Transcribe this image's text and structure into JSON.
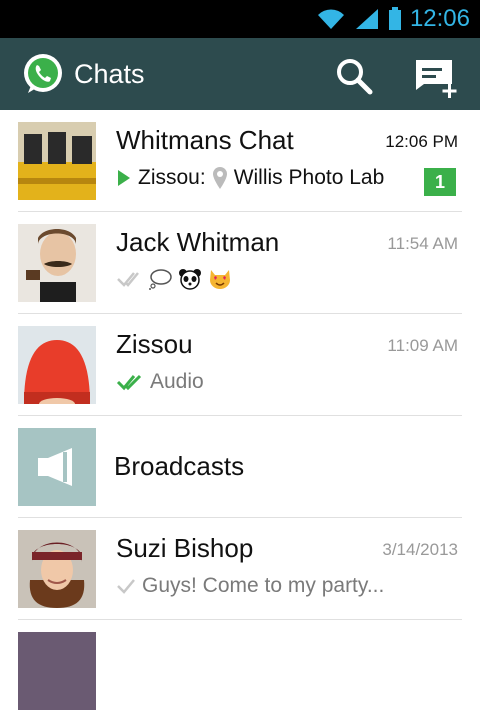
{
  "status_bar": {
    "time": "12:06"
  },
  "action_bar": {
    "title": "Chats"
  },
  "chats": [
    {
      "name": "Whitmans Chat",
      "time": "12:06 PM",
      "sender": "Zissou:",
      "preview": "Willis Photo Lab",
      "unread": "1"
    },
    {
      "name": "Jack Whitman",
      "time": "11:54 AM",
      "emoji_names": [
        "thought-balloon",
        "panda",
        "heart-eyes-cat"
      ]
    },
    {
      "name": "Zissou",
      "time": "11:09 AM",
      "preview": "Audio"
    },
    {
      "name": "Broadcasts"
    },
    {
      "name": "Suzi Bishop",
      "time": "3/14/2013",
      "preview": "Guys! Come to my party..."
    }
  ],
  "colors": {
    "action_bar": "#2d4b4e",
    "accent_green": "#3bb04a",
    "status_text": "#33b5e5"
  }
}
